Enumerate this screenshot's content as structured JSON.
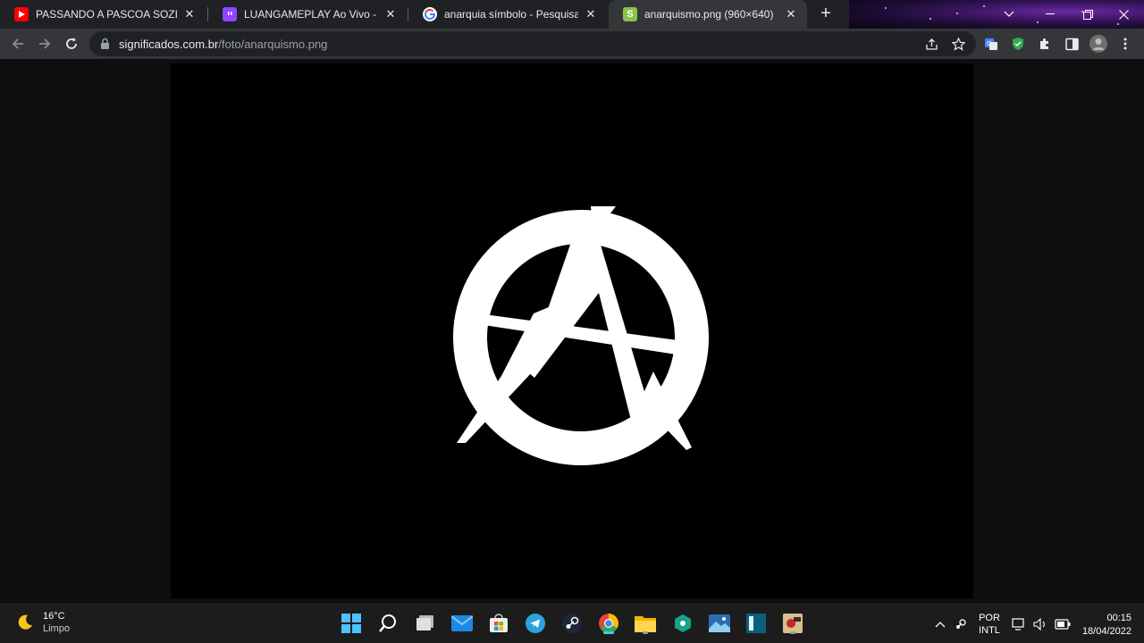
{
  "tabs": [
    {
      "title": "PASSANDO A PASCOA SOZINHO",
      "close": "✕"
    },
    {
      "title": "LUANGAMEPLAY Ao Vivo - Bate",
      "close": "✕"
    },
    {
      "title": "anarquia símbolo - Pesquisa Goo",
      "close": "✕"
    },
    {
      "title": "anarquismo.png (960×640)",
      "close": "✕"
    }
  ],
  "favicons": {
    "tab4_letter": "S"
  },
  "omnibox": {
    "domain": "significados.com.br",
    "path": "/foto/anarquismo.png"
  },
  "weather": {
    "temp": "16°C",
    "condition": "Limpo"
  },
  "tray": {
    "lang_top": "POR",
    "lang_bottom": "INTL"
  },
  "clock": {
    "time": "00:15",
    "date": "18/04/2022"
  },
  "colors": {
    "accent": "#4cc2ff",
    "tab_bg": "#202124",
    "toolbar_bg": "#35363a"
  }
}
